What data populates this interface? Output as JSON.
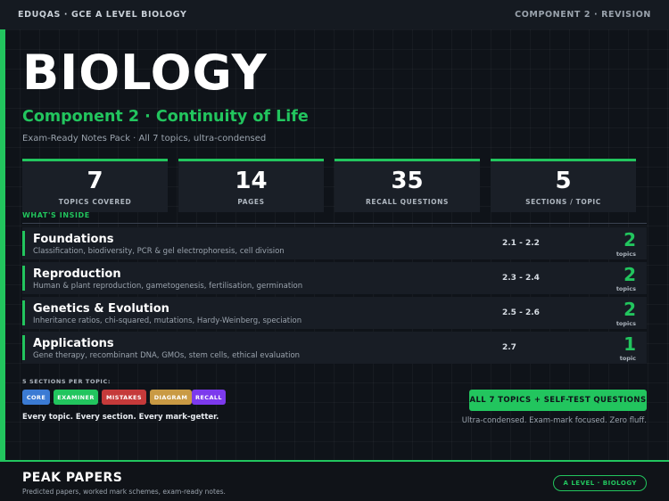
{
  "topbar": {
    "left": "EDUQAS  ·  GCE A LEVEL BIOLOGY",
    "right": "COMPONENT 2  ·  REVISION"
  },
  "hero": {
    "title": "BIOLOGY",
    "subtitle": "Component 2  ·  Continuity of Life",
    "note": "Exam-Ready Notes Pack  ·  All 7 topics, ultra-condensed"
  },
  "stats": [
    {
      "value": "7",
      "label": "TOPICS COVERED"
    },
    {
      "value": "14",
      "label": "PAGES"
    },
    {
      "value": "35",
      "label": "RECALL QUESTIONS"
    },
    {
      "value": "5",
      "label": "SECTIONS / TOPIC"
    }
  ],
  "contents": {
    "label": "WHAT'S INSIDE",
    "topics": [
      {
        "name": "Foundations",
        "desc": "Classification, biodiversity, PCR & gel electrophoresis, cell division",
        "range": "2.1 - 2.2",
        "count": "2",
        "unit": "topics"
      },
      {
        "name": "Reproduction",
        "desc": "Human & plant reproduction, gametogenesis, fertilisation, germination",
        "range": "2.3 - 2.4",
        "count": "2",
        "unit": "topics"
      },
      {
        "name": "Genetics & Evolution",
        "desc": "Inheritance ratios, chi-squared, mutations, Hardy-Weinberg, speciation",
        "range": "2.5 - 2.6",
        "count": "2",
        "unit": "topics"
      },
      {
        "name": "Applications",
        "desc": "Gene therapy, recombinant DNA, GMOs, stem cells, ethical evaluation",
        "range": "2.7",
        "count": "1",
        "unit": "topic"
      }
    ]
  },
  "sections": {
    "label": "5 SECTIONS PER TOPIC:",
    "tags": [
      {
        "label": "CORE",
        "color": "#3b7bd4"
      },
      {
        "label": "EXAMINER",
        "color": "#22c55e"
      },
      {
        "label": "MISTAKES",
        "color": "#c53a3a"
      },
      {
        "label": "DIAGRAM",
        "color": "#c99a44"
      },
      {
        "label": "RECALL",
        "color": "#7c3aed"
      }
    ],
    "tagline": "Every topic. Every section. Every mark-getter."
  },
  "cta": {
    "label": "ALL 7 TOPICS + SELF-TEST QUESTIONS",
    "note": "Ultra-condensed. Exam-mark focused. Zero fluff."
  },
  "footer": {
    "brand": "PEAK PAPERS",
    "tagline": "Predicted papers, worked mark schemes, exam-ready notes.",
    "pill": "A LEVEL  ·  BIOLOGY"
  },
  "colors": {
    "accent": "#22c55e",
    "background": "#0f1319",
    "panel": "#1a1f27"
  }
}
